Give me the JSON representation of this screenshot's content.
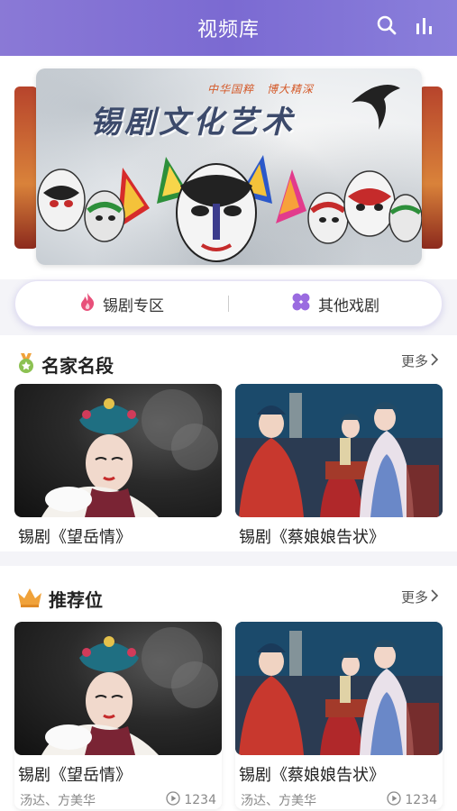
{
  "header": {
    "title": "视频库",
    "icons": [
      "search-icon",
      "chart-icon"
    ]
  },
  "banner": {
    "slogan_1": "中华国粹",
    "slogan_2": "博大精深",
    "title": "锡剧文化艺术"
  },
  "tabs": [
    {
      "label": "锡剧专区",
      "icon": "flame-icon",
      "color": "#e8507a"
    },
    {
      "label": "其他戏剧",
      "icon": "clover-icon",
      "color": "#9a6be0"
    }
  ],
  "famous": {
    "title": "名家名段",
    "more": "更多",
    "items": [
      {
        "caption": "锡剧《望岳情》"
      },
      {
        "caption": "锡剧《蔡娘娘告状》"
      }
    ]
  },
  "recommended": {
    "title": "推荐位",
    "more": "更多",
    "items": [
      {
        "caption": "锡剧《望岳情》",
        "performers": "汤达、方美华",
        "plays": "1234"
      },
      {
        "caption": "锡剧《蔡娘娘告状》",
        "performers": "汤达、方美华",
        "plays": "1234"
      }
    ]
  },
  "colors": {
    "header": "#7b6ad2",
    "accent": "#8a79d6",
    "crown": "#f0a23a",
    "medal": "#8cc152"
  }
}
